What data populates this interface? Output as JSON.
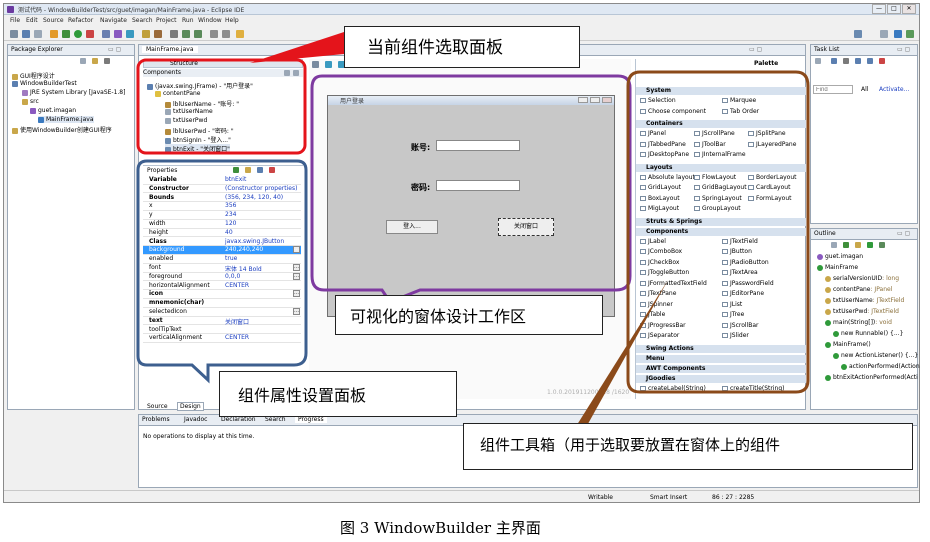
{
  "window": {
    "title": "测试代码 - WindowBuilderTest/src/guet/imagan/MainFrame.java - Eclipse IDE",
    "min_label": "—",
    "max_label": "□",
    "close_label": "✕"
  },
  "menu": [
    "File",
    "Edit",
    "Source",
    "Refactor",
    "Navigate",
    "Search",
    "Project",
    "Run",
    "Window",
    "Help"
  ],
  "package_explorer": {
    "tab": "Package Explorer",
    "items": [
      {
        "label": "GUI程序设计",
        "indent": 0
      },
      {
        "label": "WindowBuilderTest",
        "indent": 0
      },
      {
        "label": "JRE System Library [JavaSE-1.8]",
        "indent": 1
      },
      {
        "label": "src",
        "indent": 1
      },
      {
        "label": "guet.imagan",
        "indent": 2
      },
      {
        "label": "MainFrame.java",
        "indent": 3
      },
      {
        "label": "使用WindowBuilder创建GUI程序",
        "indent": 0
      }
    ]
  },
  "editor": {
    "tab": "MainFrame.java",
    "structure_label": "Structure",
    "palette_label": "Palette",
    "status_line": "1.0.0.201911200918 /1620",
    "source_tab": "Source",
    "design_tab": "Design"
  },
  "components": {
    "header": "Components",
    "tree": [
      {
        "label": "(javax.swing.JFrame) - \"用户登录\"",
        "indent": 0
      },
      {
        "label": "contentPane",
        "indent": 1
      },
      {
        "label": "lblUserName - \"账号: \"",
        "indent": 2
      },
      {
        "label": "txtUserName",
        "indent": 2
      },
      {
        "label": "txtUserPwd",
        "indent": 2
      },
      {
        "label": "lblUserPwd - \"密码: \"",
        "indent": 2
      },
      {
        "label": "btnSignIn - \"登入...\"",
        "indent": 2
      },
      {
        "label": "btnExit - \"关闭窗口\"",
        "indent": 2
      }
    ]
  },
  "properties": {
    "header": "Properties",
    "rows": [
      {
        "k": "Variable",
        "v": "btnExit",
        "bold": true
      },
      {
        "k": "Constructor",
        "v": "(Constructor properties)",
        "bold": true
      },
      {
        "k": "Bounds",
        "v": "(356, 234, 120, 40)",
        "bold": true
      },
      {
        "k": "x",
        "v": "356"
      },
      {
        "k": "y",
        "v": "234"
      },
      {
        "k": "width",
        "v": "120"
      },
      {
        "k": "height",
        "v": "40"
      },
      {
        "k": "Class",
        "v": "javax.swing.JButton",
        "bold": true
      },
      {
        "k": "background",
        "v": "240,240,240",
        "sel": true
      },
      {
        "k": "enabled",
        "v": "true"
      },
      {
        "k": "font",
        "v": "宋体 14 Bold"
      },
      {
        "k": "foreground",
        "v": "0,0,0"
      },
      {
        "k": "horizontalAlignment",
        "v": "CENTER"
      },
      {
        "k": "icon",
        "v": "",
        "bold": true
      },
      {
        "k": "mnemonic(char)",
        "v": "",
        "bold": true
      },
      {
        "k": "selectedIcon",
        "v": ""
      },
      {
        "k": "text",
        "v": "关闭窗口",
        "bold": true
      },
      {
        "k": "toolTipText",
        "v": ""
      },
      {
        "k": "verticalAlignment",
        "v": "CENTER"
      }
    ]
  },
  "design_frame": {
    "title": "用户登录",
    "label_account": "账号:",
    "label_password": "密码:",
    "btn_login": "登入...",
    "btn_close": "关闭窗口"
  },
  "palette": {
    "system": "System",
    "selection": "Selection",
    "marquee": "Marquee",
    "choose_component": "Choose component",
    "tab_order": "Tab Order",
    "containers": "Containers",
    "containers_items": [
      "JPanel",
      "JScrollPane",
      "JSplitPane",
      "JTabbedPane",
      "JToolBar",
      "JLayeredPane",
      "JDesktopPane",
      "JInternalFrame"
    ],
    "layouts": "Layouts",
    "layouts_items": [
      "Absolute layout",
      "FlowLayout",
      "BorderLayout",
      "GridLayout",
      "GridBagLayout",
      "CardLayout",
      "BoxLayout",
      "SpringLayout",
      "FormLayout",
      "MigLayout",
      "GroupLayout"
    ],
    "struts": "Struts & Springs",
    "components": "Components",
    "components_items": [
      "JLabel",
      "JTextField",
      "JComboBox",
      "JButton",
      "JCheckBox",
      "JRadioButton",
      "JToggleButton",
      "JTextArea",
      "JFormattedTextField",
      "JPasswordField",
      "JTextPane",
      "JEditorPane",
      "JSpinner",
      "JList",
      "JTable",
      "JTree",
      "JProgressBar",
      "JScrollBar",
      "JSeparator",
      "JSlider"
    ],
    "swing_actions": "Swing Actions",
    "menu": "Menu",
    "awt": "AWT Components",
    "jgoodies": "JGoodies",
    "create_label": "createLabel(String)",
    "create_title": "createTitle(String)"
  },
  "task_list": {
    "tab": "Task List",
    "find_placeholder": "Find",
    "all": "All",
    "activate": "Activate..."
  },
  "outline": {
    "tab": "Outline",
    "items": [
      {
        "label": "guet.imagan",
        "indent": 0,
        "suffix": ""
      },
      {
        "label": "MainFrame",
        "indent": 0,
        "suffix": ""
      },
      {
        "label": "serialVersionUID",
        "indent": 1,
        "suffix": ": long"
      },
      {
        "label": "contentPane",
        "indent": 1,
        "suffix": ": JPanel"
      },
      {
        "label": "txtUserName",
        "indent": 1,
        "suffix": ": JTextField"
      },
      {
        "label": "txtUserPwd",
        "indent": 1,
        "suffix": ": JTextField"
      },
      {
        "label": "main(String[])",
        "indent": 1,
        "suffix": ": void"
      },
      {
        "label": "new Runnable() {...}",
        "indent": 2,
        "suffix": ""
      },
      {
        "label": "MainFrame()",
        "indent": 1,
        "suffix": ""
      },
      {
        "label": "new ActionListener() {...}",
        "indent": 2,
        "suffix": ""
      },
      {
        "label": "actionPerformed(Action",
        "indent": 3,
        "suffix": ""
      },
      {
        "label": "btnExitActionPerformed(Acti",
        "indent": 1,
        "suffix": ""
      }
    ]
  },
  "problems": {
    "tabs": [
      "Problems",
      "Javadoc",
      "Declaration",
      "Search",
      "Progress"
    ],
    "message": "No operations to display at this time."
  },
  "statusbar": {
    "writable": "Writable",
    "insert": "Smart Insert",
    "position": "86 : 27 : 2285"
  },
  "callouts": {
    "components_panel": "当前组件选取面板",
    "design_area": "可视化的窗体设计工作区",
    "properties_panel": "组件属性设置面板",
    "toolbox": "组件工具箱（用于选取要放置在窗体上的组件"
  },
  "figure_caption": "图  3 WindowBuilder 主界面",
  "colors": {
    "red": "#e4141b",
    "blue": "#3d5f8f",
    "purple": "#7e3aa0",
    "brown": "#8b4a1a"
  }
}
